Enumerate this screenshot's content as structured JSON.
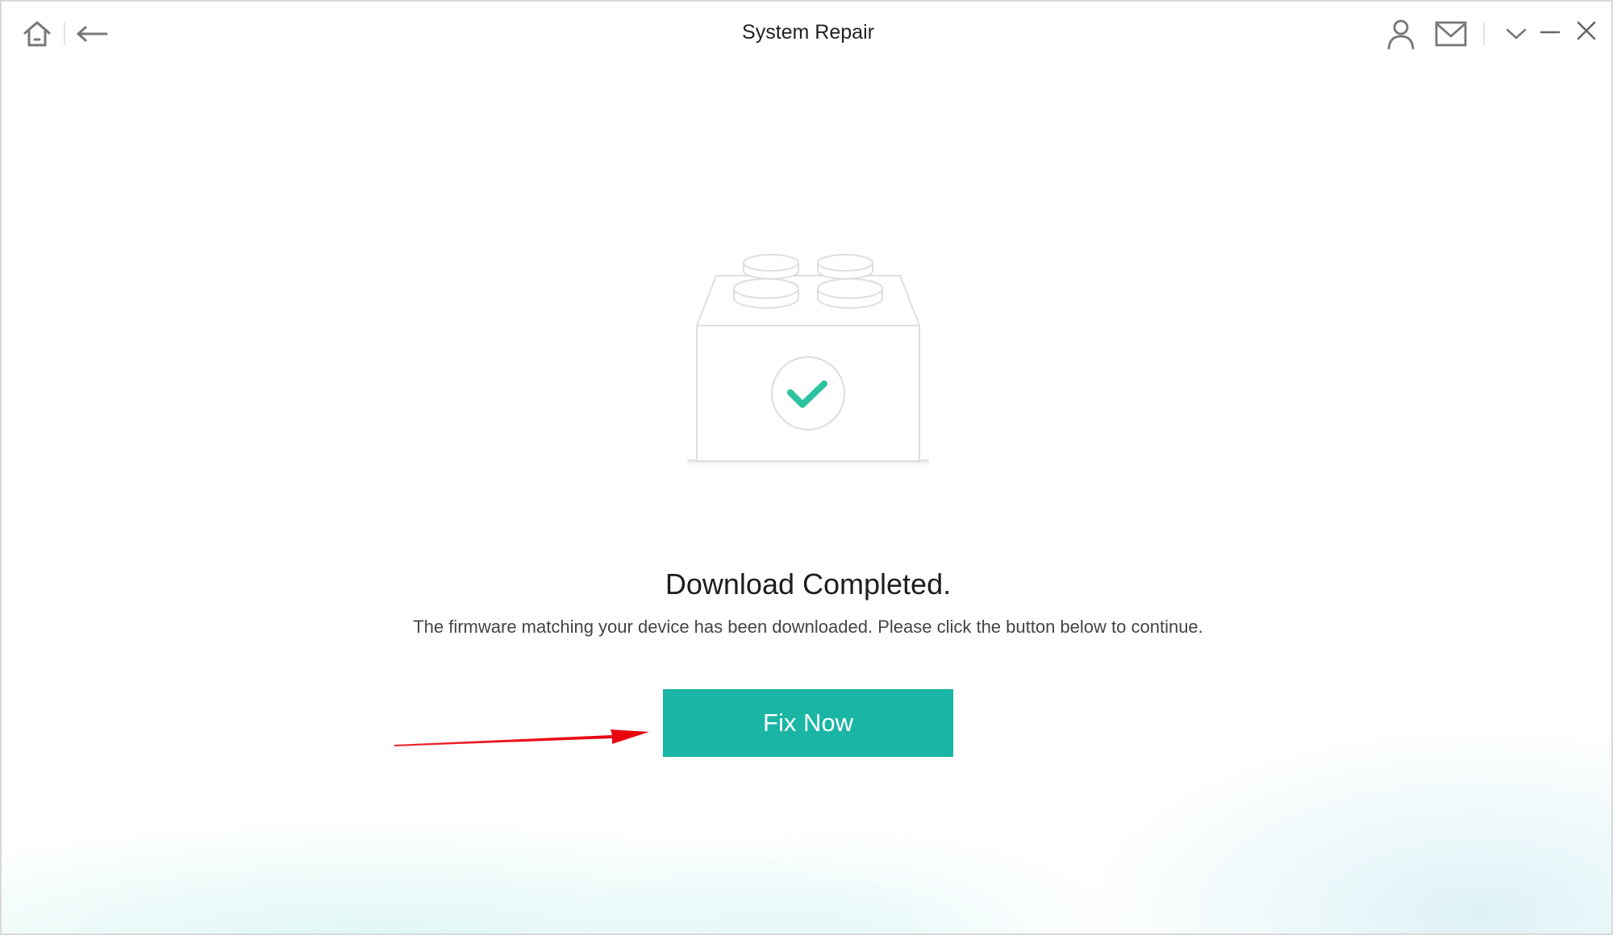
{
  "window": {
    "title": "System Repair"
  },
  "toolbar": {
    "home_icon": "home-icon",
    "back_icon": "back-arrow-icon",
    "account_icon": "user-icon",
    "mail_icon": "mail-icon",
    "menu_icon": "chevron-down-icon",
    "minimize_icon": "minimize-icon",
    "close_icon": "close-icon"
  },
  "main": {
    "illustration_icon": "lego-brick-check-icon",
    "heading": "Download Completed.",
    "description": "The firmware matching your device has been downloaded. Please click the button below to continue.",
    "primary_button": "Fix Now"
  },
  "annotation": {
    "arrow_icon": "red-arrow-icon"
  },
  "colors": {
    "accent": "#1ab5a4",
    "check": "#2cc2a0",
    "annotation_arrow": "#e8000b",
    "icon_gray": "#777777"
  }
}
